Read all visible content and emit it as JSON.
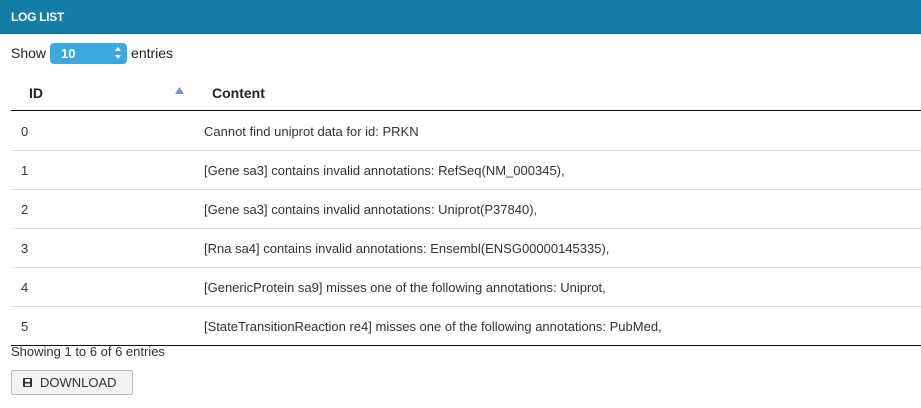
{
  "header": {
    "title": "LOG LIST"
  },
  "length_control": {
    "prefix": "Show",
    "selected_value": "10",
    "suffix": "entries"
  },
  "table": {
    "columns": [
      "ID",
      "Content"
    ],
    "sort_icon": "sort-ascending-icon",
    "rows": [
      {
        "id": "0",
        "content": "Cannot find uniprot data for id: PRKN"
      },
      {
        "id": "1",
        "content": "[Gene sa3] contains invalid annotations: RefSeq(NM_000345),"
      },
      {
        "id": "2",
        "content": "[Gene sa3] contains invalid annotations: Uniprot(P37840),"
      },
      {
        "id": "3",
        "content": "[Rna sa4] contains invalid annotations: Ensembl(ENSG00000145335),"
      },
      {
        "id": "4",
        "content": "[GenericProtein sa9] misses one of the following annotations: Uniprot,"
      },
      {
        "id": "5",
        "content": "[StateTransitionReaction re4] misses one of the following annotations: PubMed,"
      }
    ]
  },
  "footer": {
    "info": "Showing 1 to 6 of 6 entries",
    "download_label": "DOWNLOAD",
    "download_icon": "floppy-disk-icon"
  },
  "colors": {
    "header_bg": "#157ea8",
    "select_bg": "#3aa9e0"
  }
}
